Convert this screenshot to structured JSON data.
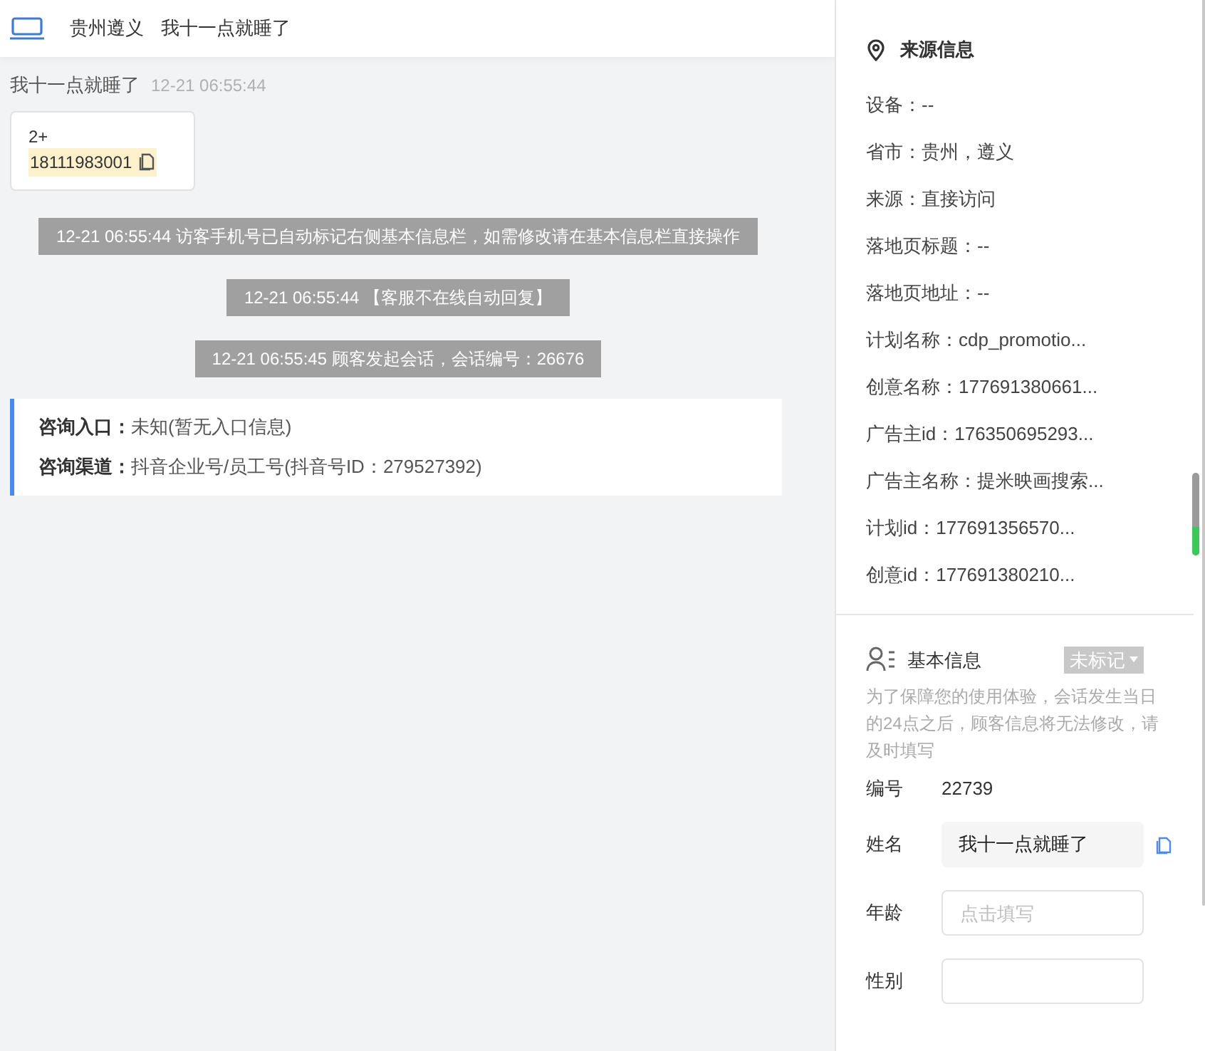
{
  "header": {
    "location": "贵州遵义",
    "visitor": "我十一点就睡了"
  },
  "chat": {
    "sender": "我十一点就睡了",
    "time": "12-21 06:55:44",
    "bubble": {
      "line1": "2+",
      "phone": "18111983001"
    },
    "system_messages": [
      "12-21 06:55:44 访客手机号已自动标记右侧基本信息栏，如需修改请在基本信息栏直接操作",
      "12-21 06:55:44 【客服不在线自动回复】",
      "12-21 06:55:45 顾客发起会话，会话编号：26676"
    ],
    "consult": [
      {
        "label": "咨询入口：",
        "value": "未知(暂无入口信息)"
      },
      {
        "label": "咨询渠道：",
        "value": "抖音企业号/员工号(抖音号ID：279527392)"
      }
    ]
  },
  "source": {
    "title": "来源信息",
    "items": [
      "设备：--",
      "省市：贵州，遵义",
      "来源：直接访问",
      "落地页标题：--",
      "落地页地址：--",
      "计划名称：cdp_promotio...",
      "创意名称：177691380661...",
      "广告主id：176350695293...",
      "广告主名称：提米映画搜索...",
      "计划id：177691356570...",
      "创意id：177691380210..."
    ]
  },
  "basic": {
    "title": "基本信息",
    "tag": "未标记",
    "notice": "为了保障您的使用体验，会话发生当日的24点之后，顾客信息将无法修改，请及时填写",
    "fields": [
      {
        "kind": "plain",
        "label": "编号",
        "value": "22739"
      },
      {
        "kind": "copy",
        "label": "姓名",
        "value": "我十一点就睡了"
      },
      {
        "kind": "input",
        "label": "年龄",
        "placeholder": "点击填写"
      },
      {
        "kind": "input",
        "label": "性别"
      }
    ]
  }
}
